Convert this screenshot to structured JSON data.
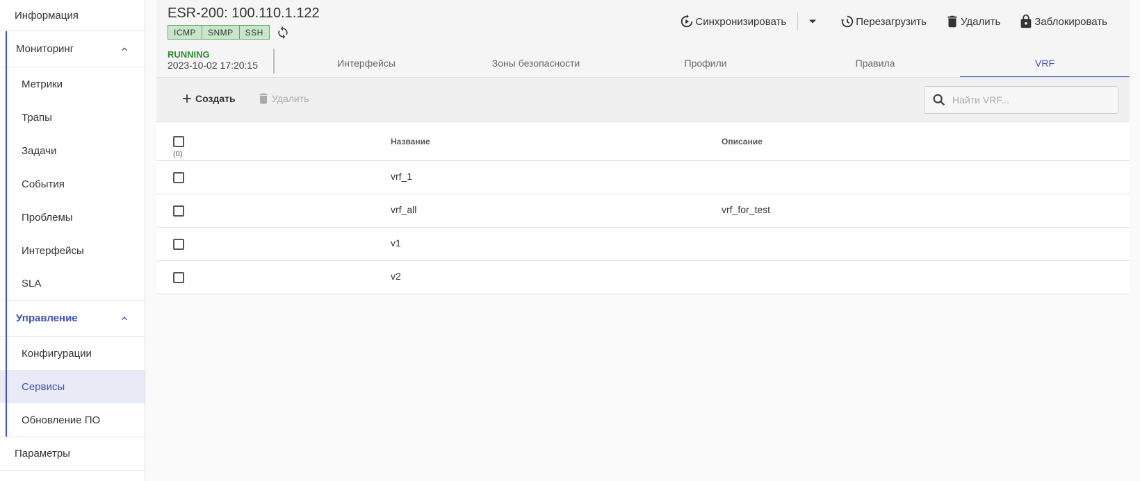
{
  "sidebar": {
    "top_item": "Информация",
    "monitoring": {
      "title": "Мониторинг",
      "items": [
        "Метрики",
        "Трапы",
        "Задачи",
        "События",
        "Проблемы",
        "Интерфейсы",
        "SLA"
      ]
    },
    "management": {
      "title": "Управление",
      "items": [
        "Конфигурации",
        "Сервисы",
        "Обновление ПО"
      ],
      "selected": "Сервисы"
    },
    "bottom_item": "Параметры"
  },
  "header": {
    "device_title": "ESR-200: 100.110.1.122",
    "badges": [
      "ICMP",
      "SNMP",
      "SSH"
    ],
    "status": "RUNNING",
    "timestamp": "2023-10-02 17:20:15",
    "actions": {
      "sync": "Синхронизировать",
      "reboot": "Перезагрузить",
      "delete": "Удалить",
      "lock": "Заблокировать"
    }
  },
  "tabs": [
    {
      "label": "Интерфейсы",
      "active": false
    },
    {
      "label": "Зоны безопасности",
      "active": false
    },
    {
      "label": "Профили",
      "active": false
    },
    {
      "label": "Правила",
      "active": false
    },
    {
      "label": "VRF",
      "active": true
    }
  ],
  "toolbar": {
    "create_label": "Создать",
    "delete_label": "Удалить",
    "search_placeholder": "Найти VRF..."
  },
  "table": {
    "columns": {
      "name": "Название",
      "description": "Описание"
    },
    "selected_count": "(0)",
    "rows": [
      {
        "name": "vrf_1",
        "description": ""
      },
      {
        "name": "vrf_all",
        "description": "vrf_for_test"
      },
      {
        "name": "v1",
        "description": ""
      },
      {
        "name": "v2",
        "description": ""
      }
    ]
  },
  "colors": {
    "accent": "#3f51b5",
    "status_running": "#2e8b2e",
    "badge_bg": "#c8e6c9"
  }
}
